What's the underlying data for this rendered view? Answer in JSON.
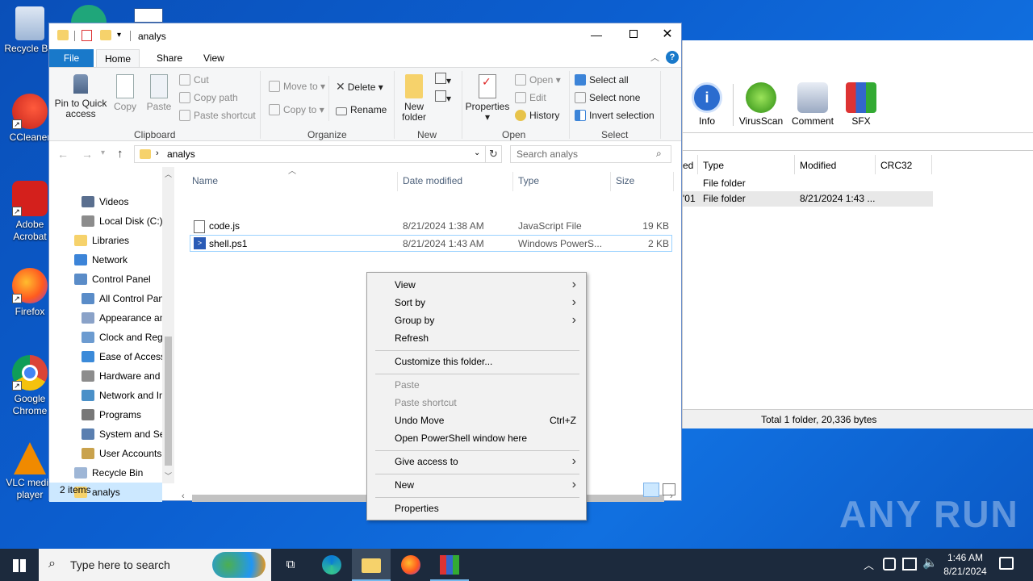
{
  "desktop": {
    "icons": [
      {
        "label": "Recycle Bin"
      },
      {
        "label": "CCleaner"
      },
      {
        "label": "Adobe Acrobat"
      },
      {
        "label": "Firefox"
      },
      {
        "label": "Google Chrome"
      },
      {
        "label": "VLC media player"
      }
    ],
    "watermark": "ANY RUN"
  },
  "winrar": {
    "toolbar": [
      {
        "label": "Info",
        "icon": "info-icon"
      },
      {
        "label": "VirusScan",
        "icon": "virus-scan-icon"
      },
      {
        "label": "Comment",
        "icon": "comment-icon"
      },
      {
        "label": "SFX",
        "icon": "sfx-icon"
      }
    ],
    "columns": [
      "ed",
      "Type",
      "Modified",
      "CRC32"
    ],
    "rows": [
      {
        "partial": "",
        "type": "File folder",
        "modified": ""
      },
      {
        "partial": "'01",
        "type": "File folder",
        "modified": "8/21/2024 1:43 ..."
      }
    ],
    "status": "Total 1 folder, 20,336 bytes"
  },
  "explorer": {
    "title": "analys",
    "tabs": {
      "file": "File",
      "home": "Home",
      "share": "Share",
      "view": "View"
    },
    "ribbon": {
      "pin": "Pin to Quick access",
      "copy": "Copy",
      "paste": "Paste",
      "cut": "Cut",
      "copy_path": "Copy path",
      "paste_shortcut": "Paste shortcut",
      "clipboard": "Clipboard",
      "move_to": "Move to",
      "copy_to": "Copy to",
      "delete": "Delete",
      "rename": "Rename",
      "organize": "Organize",
      "new_folder": "New folder",
      "new": "New",
      "properties": "Properties",
      "open": "Open",
      "edit": "Edit",
      "history": "History",
      "open_group": "Open",
      "select_all": "Select all",
      "select_none": "Select none",
      "invert_selection": "Invert selection",
      "select": "Select"
    },
    "address": {
      "path": "analys",
      "search_placeholder": "Search analys"
    },
    "nav": [
      {
        "label": "Videos",
        "indent": 1
      },
      {
        "label": "Local Disk (C:)",
        "indent": 1
      },
      {
        "label": "Libraries",
        "indent": 0
      },
      {
        "label": "Network",
        "indent": 0
      },
      {
        "label": "Control Panel",
        "indent": 0
      },
      {
        "label": "All Control Panel Items",
        "indent": 1
      },
      {
        "label": "Appearance and Personalization",
        "indent": 1
      },
      {
        "label": "Clock and Region",
        "indent": 1
      },
      {
        "label": "Ease of Access",
        "indent": 1
      },
      {
        "label": "Hardware and Sound",
        "indent": 1
      },
      {
        "label": "Network and Internet",
        "indent": 1
      },
      {
        "label": "Programs",
        "indent": 1
      },
      {
        "label": "System and Security",
        "indent": 1
      },
      {
        "label": "User Accounts",
        "indent": 1
      },
      {
        "label": "Recycle Bin",
        "indent": 0
      },
      {
        "label": "analys",
        "indent": 0
      }
    ],
    "columns": {
      "name": "Name",
      "modified": "Date modified",
      "type": "Type",
      "size": "Size"
    },
    "files": [
      {
        "name": "code.js",
        "modified": "8/21/2024 1:38 AM",
        "type": "JavaScript File",
        "size": "19 KB"
      },
      {
        "name": "shell.ps1",
        "modified": "8/21/2024 1:43 AM",
        "type": "Windows PowerS...",
        "size": "2 KB"
      }
    ],
    "status": "2 items"
  },
  "context_menu": {
    "view": "View",
    "sort_by": "Sort by",
    "group_by": "Group by",
    "refresh": "Refresh",
    "customize": "Customize this folder...",
    "paste": "Paste",
    "paste_shortcut": "Paste shortcut",
    "undo_move": "Undo Move",
    "undo_shortcut": "Ctrl+Z",
    "open_powershell": "Open PowerShell window here",
    "give_access": "Give access to",
    "new": "New",
    "properties": "Properties"
  },
  "taskbar": {
    "search_placeholder": "Type here to search",
    "time": "1:46 AM",
    "date": "8/21/2024"
  }
}
